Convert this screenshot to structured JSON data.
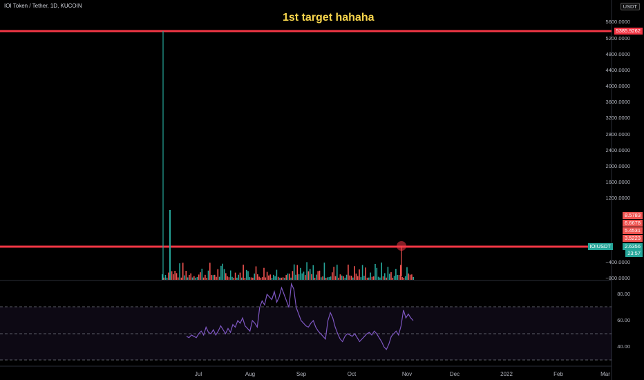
{
  "header": {
    "title": "IOI Token / Tether, 1D, KUCOIN",
    "banner": "1st target hahaha",
    "currency": "USDT"
  },
  "price_axis": {
    "labels": [
      "5600.0000",
      "5200.0000",
      "4800.0000",
      "4400.0000",
      "4000.0000",
      "3600.0000",
      "3200.0000",
      "2800.0000",
      "2400.0000",
      "2000.0000",
      "1600.0000",
      "1200.0000",
      "−400.0000",
      "−800.0000"
    ],
    "tags": {
      "upper_line": "5385.9262",
      "vals": [
        "8.5783",
        "6.6678",
        "5.4531",
        "3.5223"
      ],
      "symbol": "IOIUSDT",
      "last": "2.6356",
      "countdown": "23:57"
    }
  },
  "rsi_axis": {
    "labels": [
      "80.00",
      "60.00",
      "40.00"
    ]
  },
  "time_axis": {
    "labels": [
      "Jul",
      "Aug",
      "Sep",
      "Oct",
      "Nov",
      "Dec",
      "2022",
      "Feb",
      "Mar"
    ]
  },
  "colors": {
    "up": "#26a69a",
    "down": "#ef5350",
    "line": "#f23645",
    "rsi": "#7e57c2",
    "banner": "#f7d54c"
  },
  "chart_data": {
    "type": "bar",
    "price_levels": [
      5385.9262,
      1.0
    ],
    "rsi_bands": [
      70,
      50,
      30
    ],
    "rsi_values": [
      48,
      47,
      49,
      48,
      47,
      50,
      52,
      49,
      55,
      51,
      50,
      53,
      49,
      52,
      56,
      53,
      50,
      54,
      51,
      57,
      55,
      60,
      58,
      62,
      56,
      54,
      52,
      60,
      58,
      55,
      70,
      75,
      72,
      80,
      78,
      76,
      82,
      74,
      78,
      85,
      80,
      75,
      70,
      88,
      84,
      70,
      65,
      60,
      58,
      56,
      55,
      58,
      60,
      55,
      52,
      50,
      48,
      46,
      60,
      66,
      62,
      55,
      50,
      46,
      44,
      48,
      50,
      49,
      48,
      50,
      47,
      44,
      46,
      48,
      50,
      51,
      49,
      52,
      50,
      47,
      44,
      40,
      38,
      42,
      48,
      50,
      52,
      49,
      56,
      68,
      62,
      65,
      62,
      60
    ]
  }
}
